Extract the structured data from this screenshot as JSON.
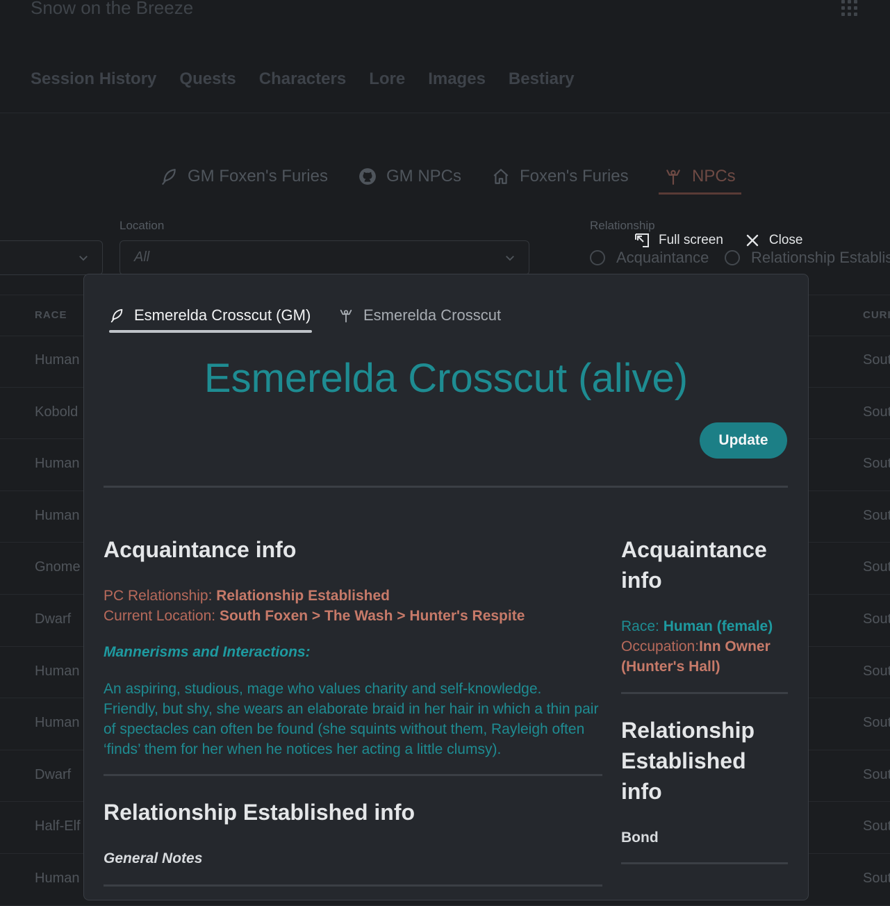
{
  "app": {
    "title": "Snow on the Breeze",
    "nav": [
      "Session History",
      "Quests",
      "Characters",
      "Lore",
      "Images",
      "Bestiary"
    ]
  },
  "subtabs": [
    {
      "label": "GM Foxen's Furies",
      "icon": "feather-icon"
    },
    {
      "label": "GM NPCs",
      "icon": "github-icon"
    },
    {
      "label": "Foxen's Furies",
      "icon": "home-icon"
    },
    {
      "label": "NPCs",
      "icon": "person-icon",
      "active": true
    }
  ],
  "filters": {
    "location_label": "Location",
    "location_value": "All",
    "relationship_label": "Relationship",
    "relationship_options": [
      "Acquaintance",
      "Relationship Establis"
    ]
  },
  "table": {
    "headers": [
      "RACE",
      "CURI"
    ],
    "rows": [
      {
        "race": "Human",
        "current": "Sout"
      },
      {
        "race": "Kobold",
        "current": "Sout"
      },
      {
        "race": "Human",
        "current": "Sout"
      },
      {
        "race": "Human",
        "current": "Sout"
      },
      {
        "race": "Gnome",
        "current": "Sout"
      },
      {
        "race": "Dwarf",
        "current": "Sout"
      },
      {
        "race": "Human",
        "current": "Sout"
      },
      {
        "race": "Human",
        "current": "Sout"
      },
      {
        "race": "Dwarf",
        "current": "Sout"
      },
      {
        "race": "Half-Elf",
        "current": "Sout"
      },
      {
        "race": "Human",
        "current": "Sout"
      }
    ]
  },
  "modal_tools": {
    "fullscreen": "Full screen",
    "close": "Close"
  },
  "modal": {
    "tabs": [
      {
        "label": "Esmerelda Crosscut (GM)",
        "icon": "feather-icon",
        "active": true
      },
      {
        "label": "Esmerelda Crosscut",
        "icon": "person-icon"
      }
    ],
    "heading": "Esmerelda Crosscut (alive)",
    "update_label": "Update",
    "acquaintance": {
      "title": "Acquaintance info",
      "pc_relationship_label": "PC Relationship: ",
      "pc_relationship_value": "Relationship Established",
      "location_label": "Current Location: ",
      "location_value": "South Foxen > The Wash > Hunter's Respite",
      "mannerisms_title": "Mannerisms and Interactions:",
      "mannerisms_text": "An aspiring, studious, mage who values charity and self-knowledge. Friendly, but shy, she wears an elaborate braid in her hair in which a thin pair of spectacles can often be found (she squints without them, Rayleigh often ‘finds’ them for her when he notices her acting a little clumsy)."
    },
    "relationship": {
      "title": "Relationship Established info",
      "general_notes": "General Notes"
    },
    "side": {
      "acq_title": "Acquaintance info",
      "race_label": "Race: ",
      "race_value": "Human (female)",
      "occupation_label": "Occupation:",
      "occupation_value": "Inn Owner (Hunter's Hall)",
      "rel_title": "Relationship Established info",
      "bond_label": "Bond"
    }
  }
}
